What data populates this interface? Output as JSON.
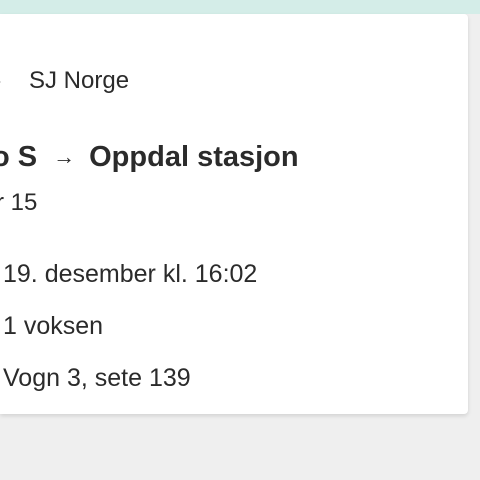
{
  "ticket": {
    "operator": "SJ Norge",
    "route": {
      "from": "o S",
      "to": "Oppdal stasjon"
    },
    "train_number": "r 15",
    "departure": "19. desember kl. 16:02",
    "passengers": "1 voksen",
    "seat": "Vogn 3, sete 139"
  },
  "icons": {
    "operator_icon": "chevron-icon",
    "route_arrow": "arrow-right-icon"
  },
  "colors": {
    "top_strip": "#d4ede8",
    "card": "#ffffff",
    "background": "#efefef",
    "text": "#2b2b2b"
  }
}
